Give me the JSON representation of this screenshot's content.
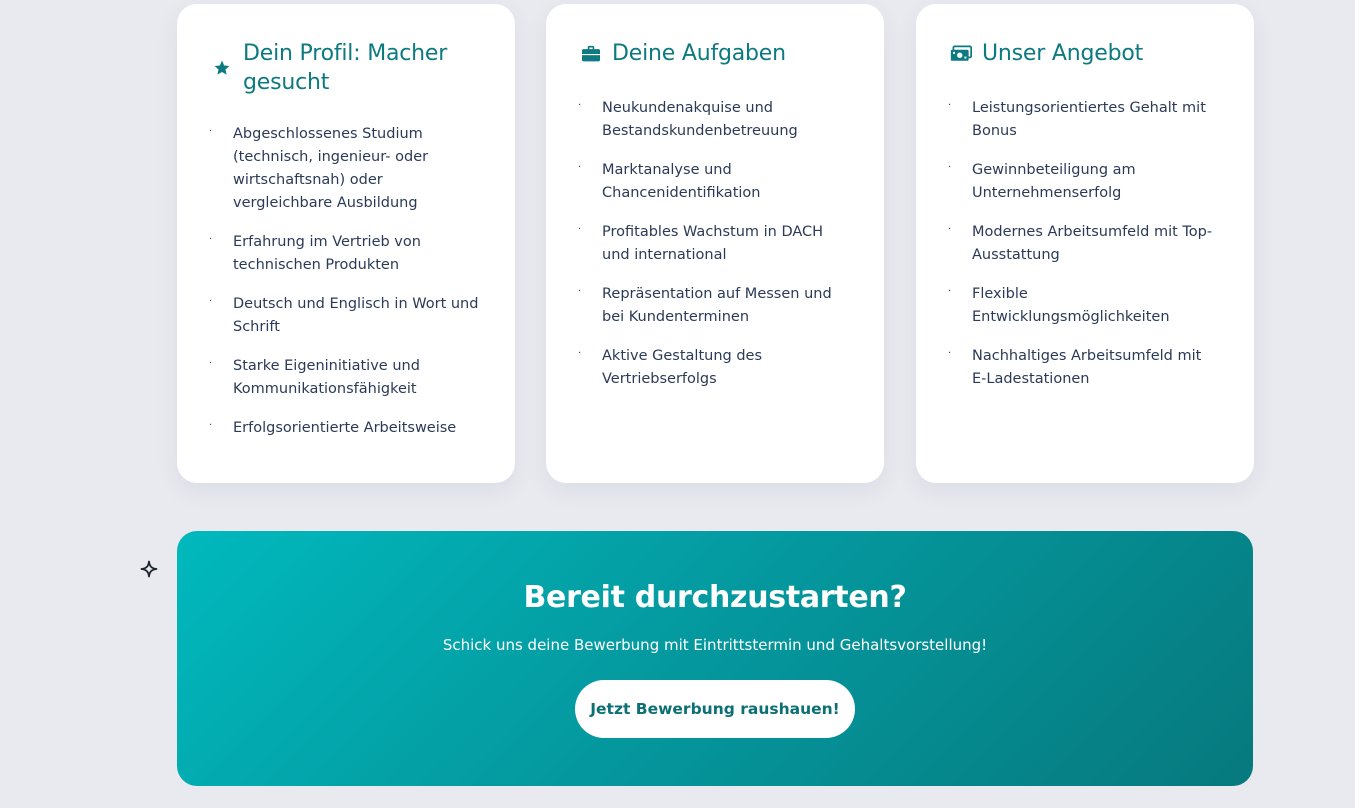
{
  "colors": {
    "accent": "#0c7a80",
    "page_background": "#e9eaf0",
    "card_background": "#ffffff",
    "cta_gradient_start": "#00b9bd",
    "cta_gradient_end": "#06797d",
    "body_text": "#2b3a57"
  },
  "cards": [
    {
      "icon": "star-icon",
      "title": "Dein Profil: Macher gesucht",
      "items": [
        "Abgeschlossenes Studium (technisch, ingenieur- oder wirtschaftsnah) oder vergleichbare Ausbildung",
        "Erfahrung im Vertrieb von technischen Produkten",
        "Deutsch und Englisch in Wort und Schrift",
        "Starke Eigeninitiative und Kommunikationsfähigkeit",
        "Erfolgsorientierte Arbeitsweise"
      ]
    },
    {
      "icon": "briefcase-icon",
      "title": "Deine Aufgaben",
      "items": [
        "Neukundenakquise und Bestandskundenbetreuung",
        "Marktanalyse und Chancenidentifikation",
        "Profitables Wachstum in DACH und international",
        "Repräsentation auf Messen und bei Kundenterminen",
        "Aktive Gestaltung des Vertriebserfolgs"
      ]
    },
    {
      "icon": "money-bill-icon",
      "title": "Unser Angebot",
      "items": [
        "Leistungsorientiertes Gehalt mit Bonus",
        "Gewinnbeteiligung am Unternehmenserfolg",
        "Modernes Arbeitsumfeld mit Top-Ausstattung",
        "Flexible Entwicklungsmöglichkeiten",
        "Nachhaltiges Arbeitsumfeld mit E-Ladestationen"
      ]
    }
  ],
  "bullet_glyph": "·",
  "sparkle_icon": "sparkle-icon",
  "cta": {
    "title": "Bereit durchzustarten?",
    "subtitle": "Schick uns deine Bewerbung mit Eintrittstermin und Gehaltsvorstellung!",
    "button_label": "Jetzt Bewerbung raushauen!"
  }
}
